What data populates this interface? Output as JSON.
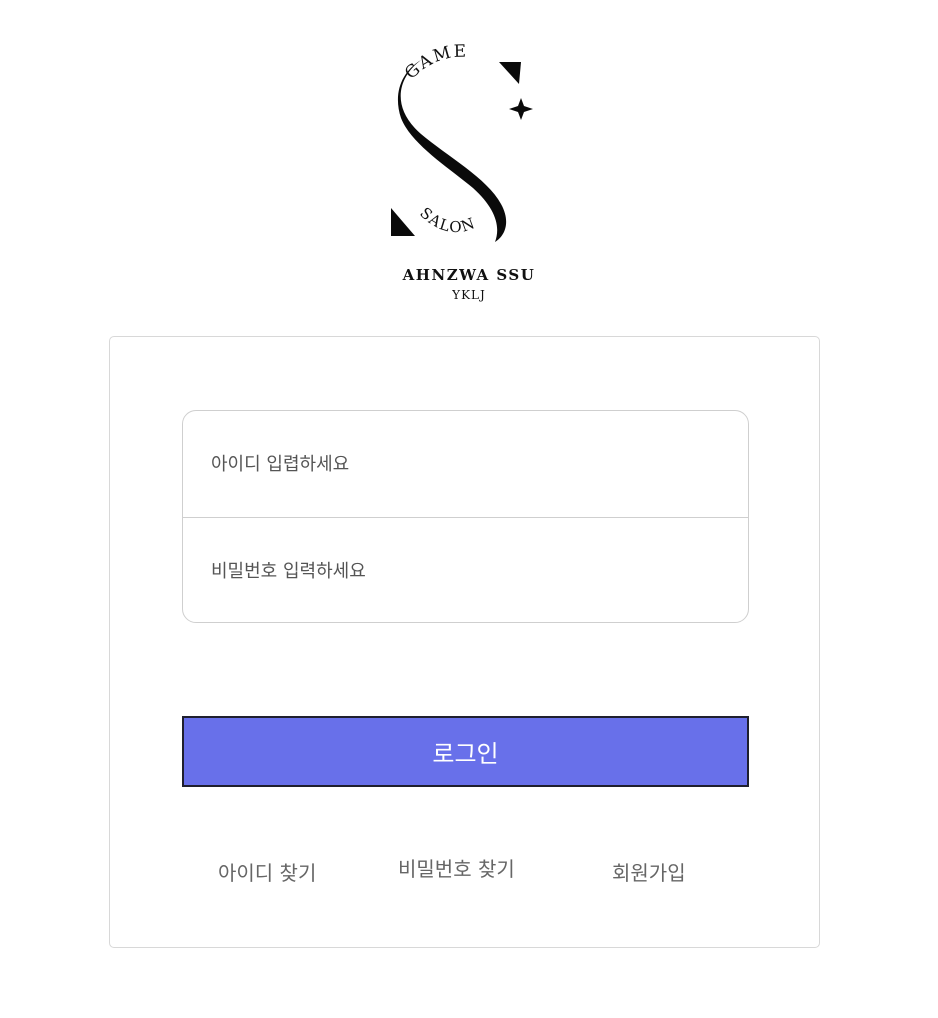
{
  "logo": {
    "arc_top": "GAME",
    "arc_bottom": "SALON",
    "brand": "AHNZWA SSU",
    "sub": "YKLJ"
  },
  "form": {
    "id_placeholder": "아이디 입렵하세요",
    "pw_placeholder": "비밀번호 입력하세요",
    "login_label": "로그인"
  },
  "links": {
    "find_id": "아이디 찾기",
    "find_pw": "비밀번호 찾기",
    "signup": "회원가입"
  },
  "colors": {
    "accent": "#6870ea",
    "card_border": "#d8d8d8",
    "link_text": "#666666"
  }
}
